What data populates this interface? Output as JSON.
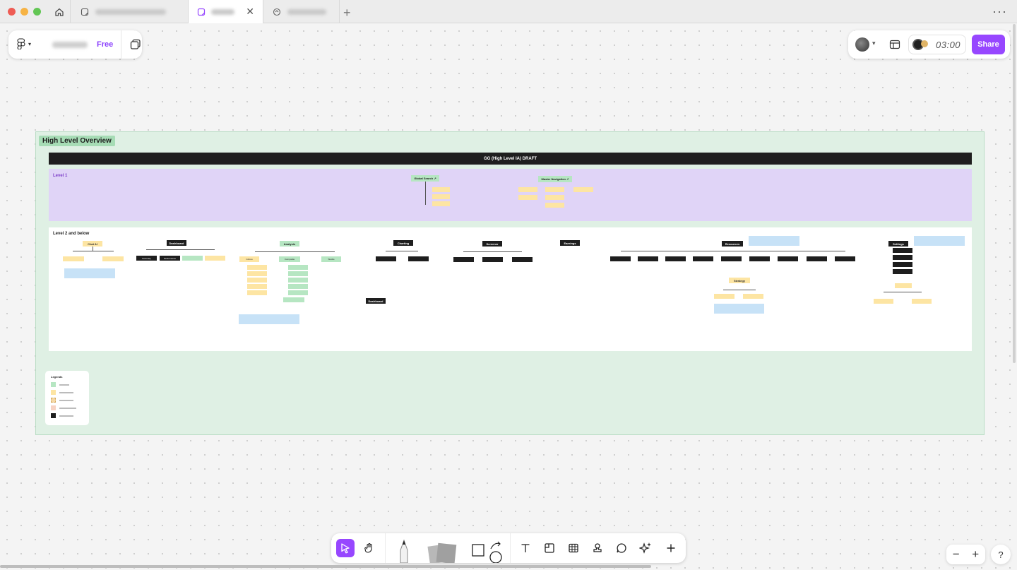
{
  "window": {
    "traffic_colors": [
      "#ee5c54",
      "#f6b344",
      "#62c654"
    ],
    "more_label": "···"
  },
  "tabs": [
    {
      "icon": "figjam-file-icon",
      "active": false
    },
    {
      "icon": "figjam-file-icon",
      "active": true
    },
    {
      "icon": "slides-file-icon",
      "active": false
    }
  ],
  "new_tab_label": "+",
  "file_panel": {
    "plan": "Free"
  },
  "header_right": {
    "timer": "03:00",
    "share": "Share"
  },
  "board": {
    "section_title": "High Level Overview",
    "draft_title": "GG (High Level IA) DRAFT",
    "level1_label": "Level 1",
    "level2_label": "Level 2 and below",
    "level1_nodes": {
      "global_search": "Global Search ↗",
      "master_navigation": "Master Navigation ↗"
    },
    "level2_nodes": {
      "chat_ai": "Chat AI",
      "dashboard": "Dashboard",
      "analysis": "Analysis",
      "charting": "Charting",
      "screener": "Screener",
      "earnings": "Earnings",
      "resources": "Resources",
      "settings": "Settings",
      "strategy": "Strategy",
      "dashboard_2": "Dashboard",
      "summary": "Summary",
      "performance": "Performance",
      "indices": "Indices",
      "composite": "Composite",
      "stocks": "Stocks",
      "objective": "Objective"
    },
    "legend": {
      "title": "Legends"
    }
  },
  "toolbar": {
    "tools": [
      "cursor-icon",
      "hand-icon",
      "pen-icon",
      "sticky-icon",
      "shape-icon",
      "text-icon",
      "section-icon",
      "table-icon",
      "stamp-icon",
      "comment-icon",
      "ai-sparkle-icon",
      "add-icon"
    ]
  },
  "zoom": {
    "minus": "−",
    "plus": "+"
  },
  "help_label": "?"
}
